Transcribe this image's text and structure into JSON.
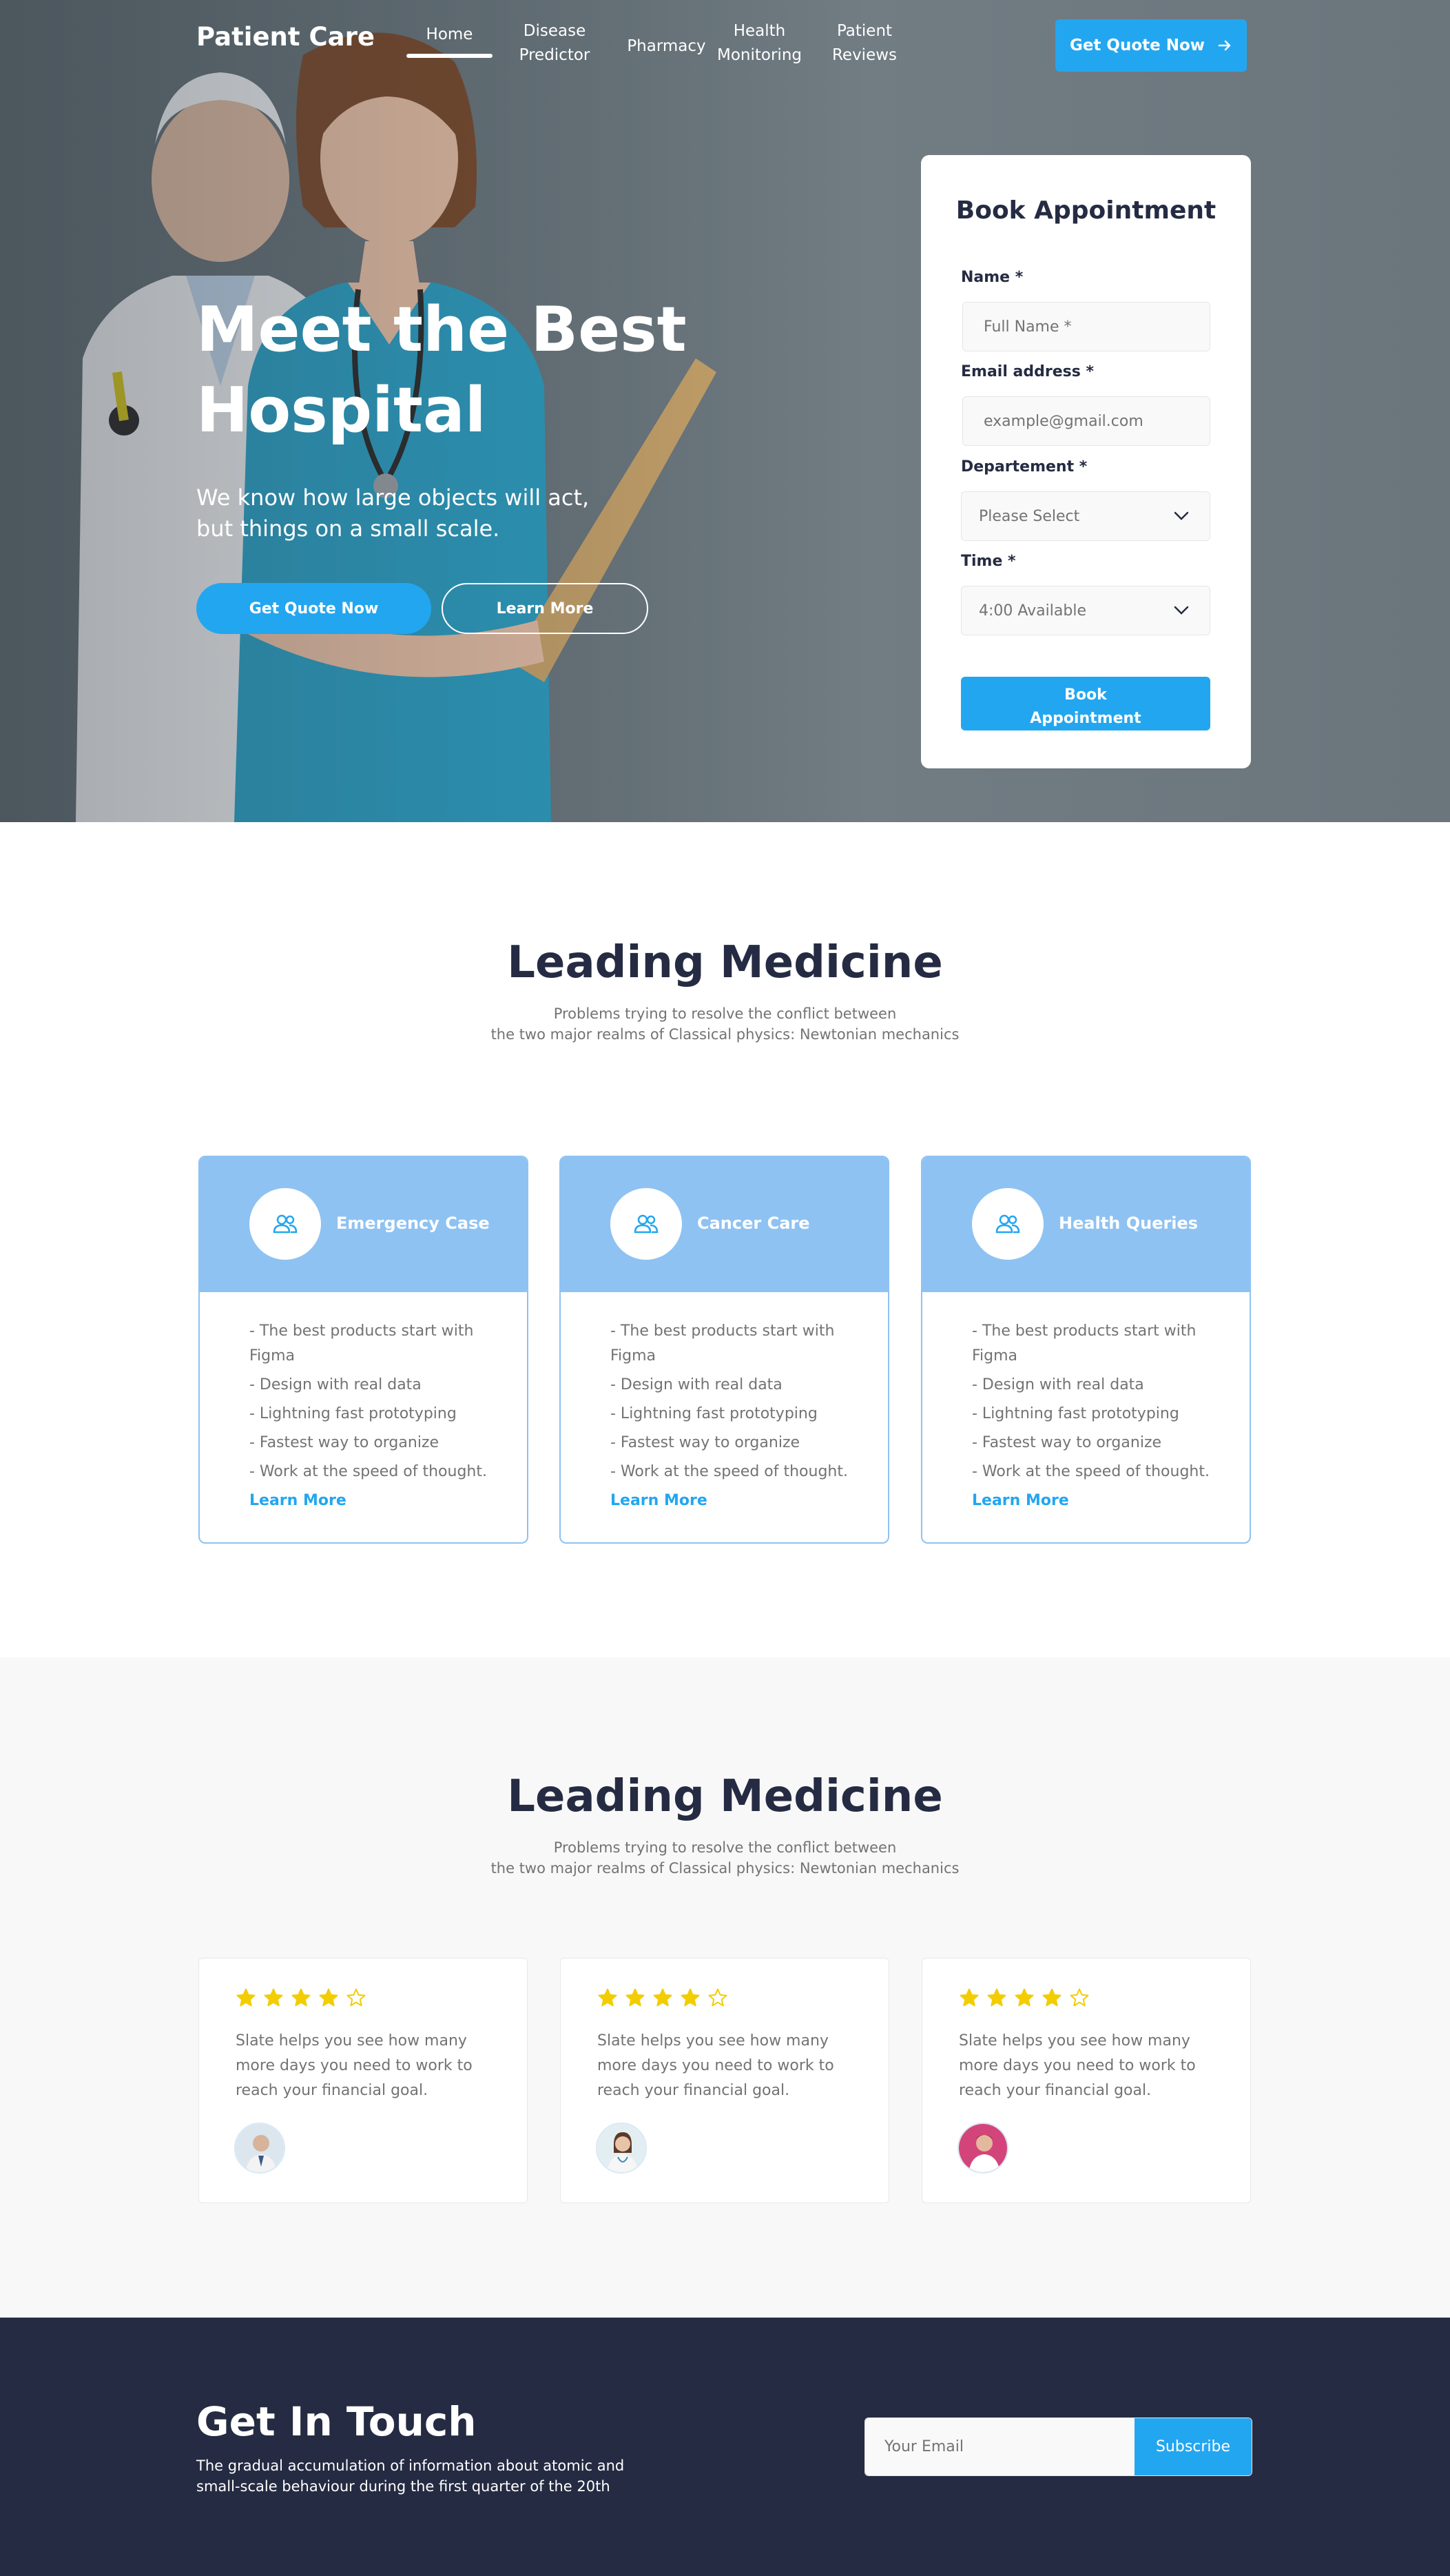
{
  "header": {
    "brand": "Patient Care",
    "nav": [
      {
        "label": "Home"
      },
      {
        "label_line1": "Disease",
        "label_line2": "Predictor"
      },
      {
        "label": "Pharmacy"
      },
      {
        "label_line1": "Health",
        "label_line2": "Monitoring"
      },
      {
        "label_line1": "Patient",
        "label_line2": "Reviews"
      }
    ],
    "cta_label": "Get Quote Now"
  },
  "hero": {
    "title_line1": "Meet the Best",
    "title_line2": "Hospital",
    "text_line1": "We know how large objects will act,",
    "text_line2": "but things on a small scale.",
    "primary_button": "Get Quote Now",
    "secondary_button": "Learn More"
  },
  "booking": {
    "title": "Book Appointment",
    "name_label": "Name *",
    "name_placeholder": "Full Name *",
    "email_label": "Email address *",
    "email_placeholder": "example@gmail.com",
    "department_label": "Departement *",
    "department_value": "Please Select",
    "time_label": "Time *",
    "time_value": "4:00 Available",
    "submit_line1": "Book",
    "submit_line2": "Appointment"
  },
  "services": {
    "title": "Leading Medicine",
    "subtitle_line1": "Problems trying to resolve the conflict between",
    "subtitle_line2": "the two major realms of Classical physics: Newtonian mechanics",
    "cards": [
      {
        "name": "Emergency Case",
        "items": [
          "-  The best products start with Figma",
          "- Design with real data",
          "- Lightning fast prototyping",
          "- Fastest way to organize",
          "- Work at the speed of thought."
        ],
        "link": "Learn More"
      },
      {
        "name": "Cancer Care",
        "items": [
          "-  The best products start with Figma",
          "- Design with real data",
          "- Lightning fast prototyping",
          "- Fastest way to organize",
          "- Work at the speed of thought."
        ],
        "link": "Learn More"
      },
      {
        "name": "Health Queries",
        "items": [
          "-  The best products start with Figma",
          "- Design with real data",
          "- Lightning fast prototyping",
          "- Fastest way to organize",
          "- Work at the speed of thought."
        ],
        "link": "Learn More"
      }
    ]
  },
  "testimonials": {
    "title": "Leading Medicine",
    "subtitle_line1": "Problems trying to resolve the conflict between",
    "subtitle_line2": "the two major realms of Classical physics: Newtonian mechanics",
    "cards": [
      {
        "rating": 4,
        "text": "Slate helps you see how many more days you need to work to reach your financial goal."
      },
      {
        "rating": 4,
        "text": "Slate helps you see how many more days you need to work to reach your financial goal."
      },
      {
        "rating": 4,
        "text": "Slate helps you see how many more days you need to work to reach your financial goal."
      }
    ]
  },
  "footer": {
    "title": "Get In Touch",
    "text_line1": "The gradual accumulation of information about atomic and",
    "text_line2": "small-scale behaviour during the first quarter of the 20th",
    "email_placeholder": "Your Email",
    "subscribe_label": "Subscribe"
  },
  "colors": {
    "primary": "#23a6f0",
    "dark": "#252b42",
    "card_header": "#8ec2f2",
    "star": "#f3cd03",
    "muted_text": "#737373"
  }
}
